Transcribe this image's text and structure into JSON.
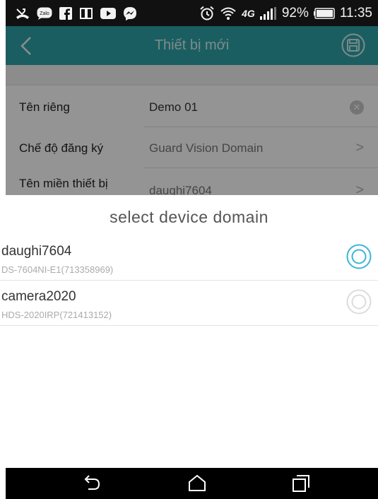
{
  "status_bar": {
    "battery": "92%",
    "time": "11:35",
    "network": "4G",
    "icons": [
      "missed-call-icon",
      "zalo-icon",
      "facebook-icon",
      "book-icon",
      "youtube-icon",
      "messenger-icon",
      "alarm-icon",
      "wifi-icon",
      "network-icon",
      "signal-icon",
      "battery-icon"
    ],
    "zalo_label": "Zalo"
  },
  "app_bar": {
    "title": "Thiết bị mới",
    "back_icon": "chevron-left-icon",
    "save_icon": "save-icon",
    "color": "#30a3a9"
  },
  "form": {
    "rows": [
      {
        "label": "Tên riêng",
        "value": "Demo 01",
        "action_icon": "clear-icon"
      },
      {
        "label": "Chế độ đăng ký",
        "value": "Guard Vision Domain",
        "action_icon": "chevron-right-icon"
      },
      {
        "label": "Tên miền thiết bị",
        "value": "daughi7604",
        "action_icon": "chevron-right-icon"
      }
    ]
  },
  "dialog": {
    "title": "select device domain",
    "options": [
      {
        "name": "daughi7604",
        "detail": "DS-7604NI-E1(713358969)",
        "selected": true
      },
      {
        "name": "camera2020",
        "detail": "HDS-2020IRP(721413152)",
        "selected": false
      }
    ],
    "accent_color": "#3ab4d8"
  },
  "nav_bar": {
    "icons": [
      "back-icon",
      "home-icon",
      "recent-apps-icon"
    ]
  }
}
